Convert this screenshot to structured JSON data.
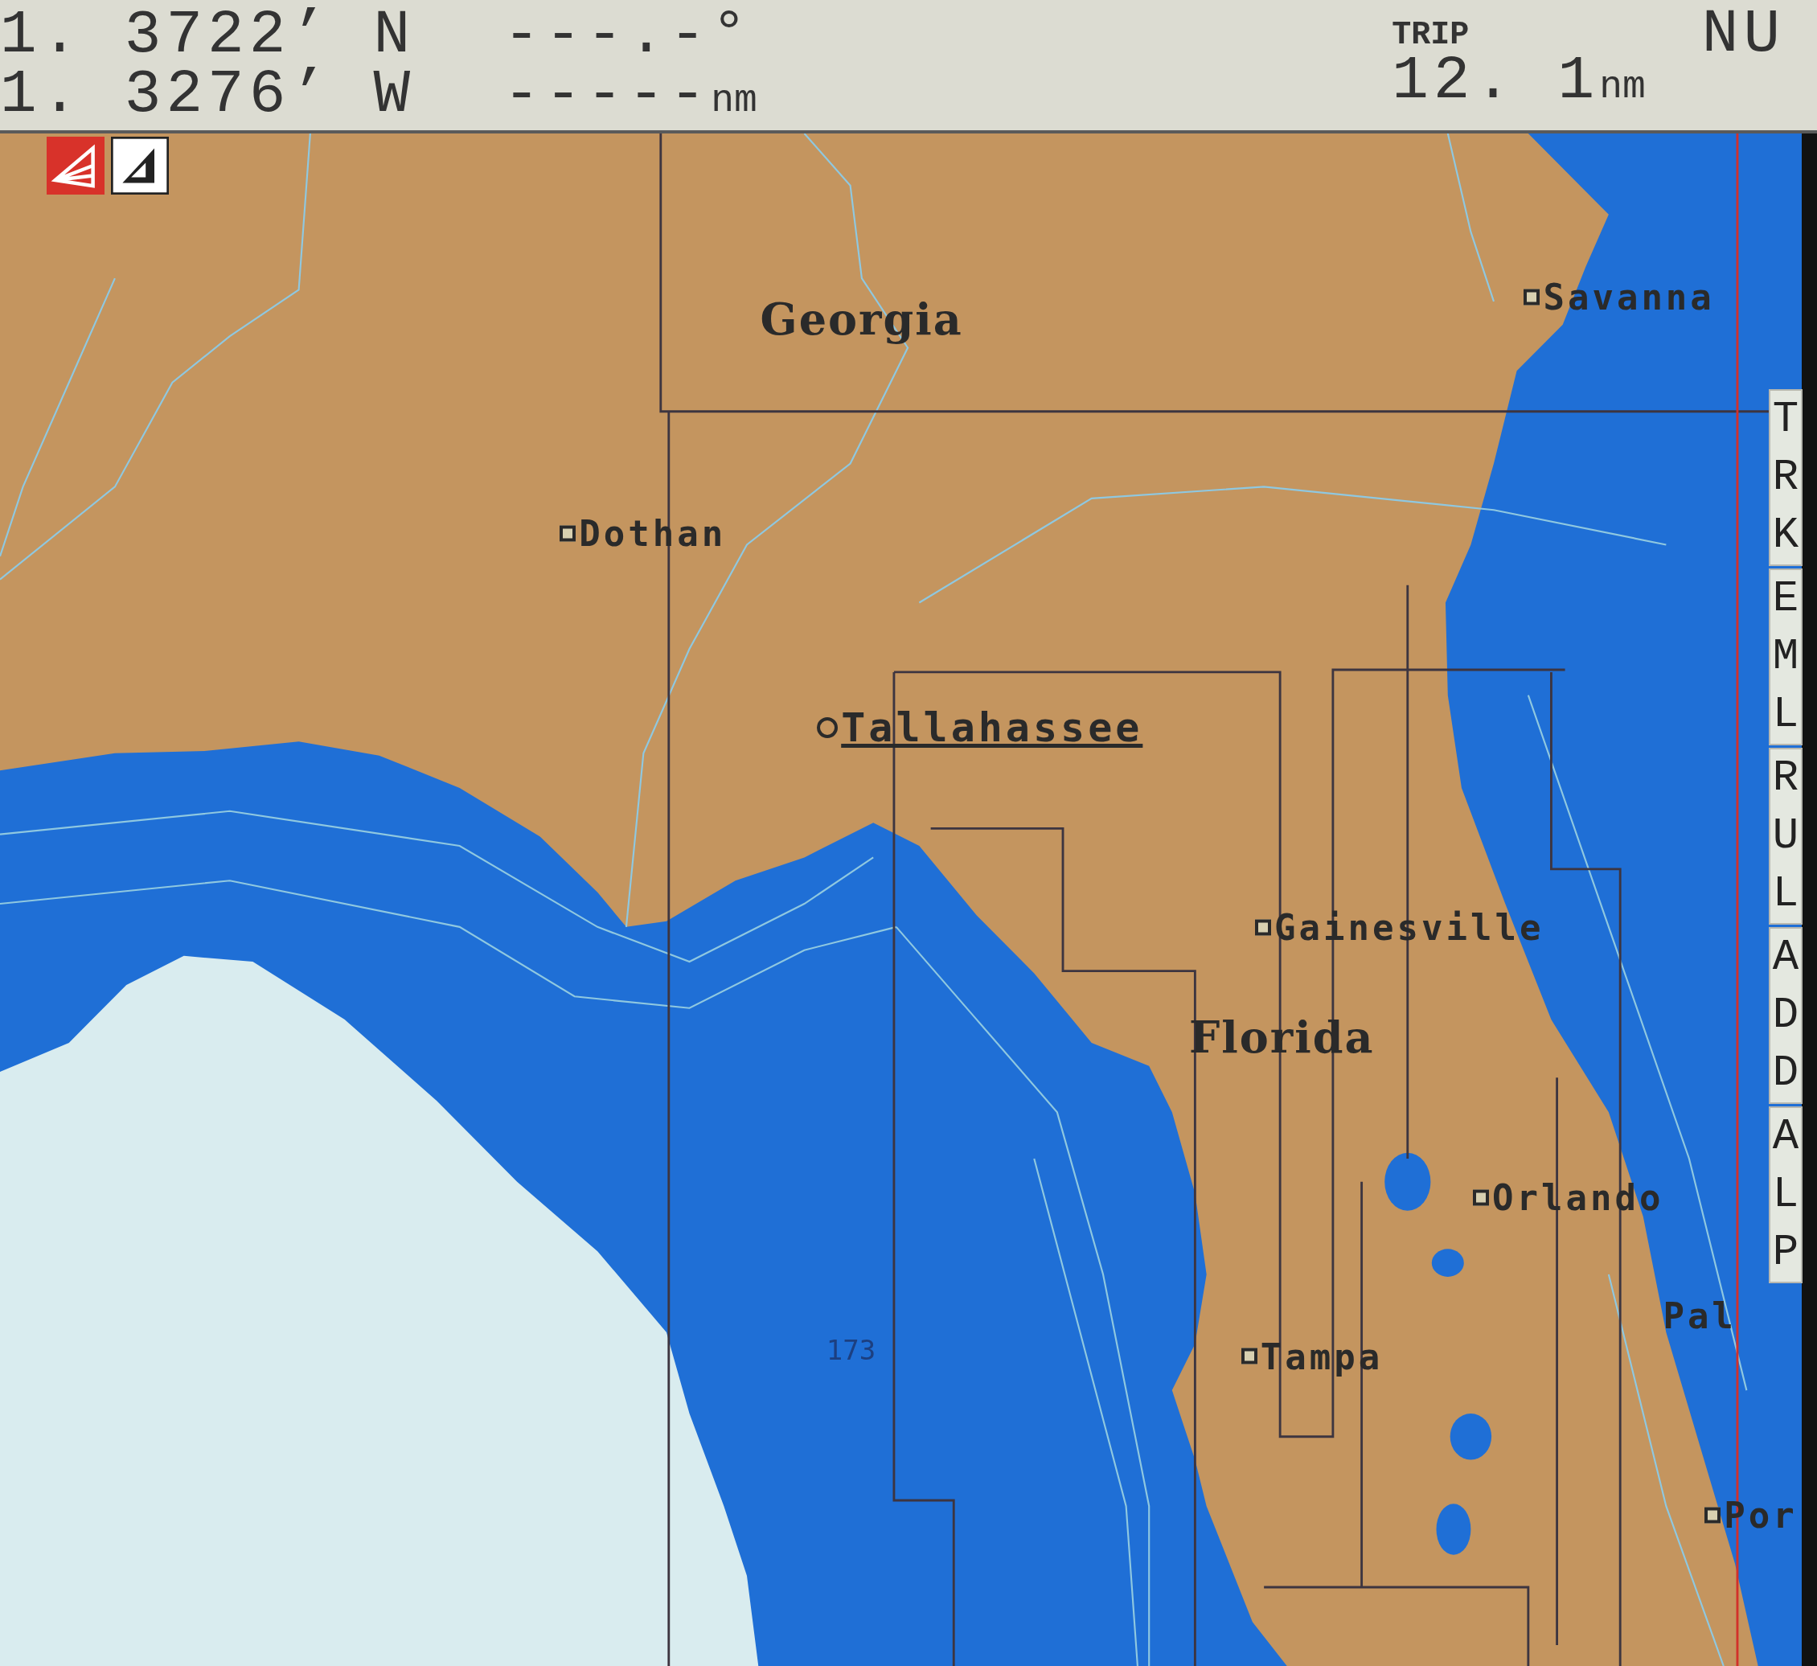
{
  "status_bar": {
    "latitude": "1. 3722’ N",
    "longitude": "1. 3276’ W",
    "heading": "---.-°",
    "distance_value": "-----",
    "distance_unit": "nm",
    "trip_label": "TRIP",
    "trip_value": "12. 1",
    "trip_unit": "nm",
    "orientation": "NU"
  },
  "map_labels": [
    {
      "text": "Georgia",
      "kind": "region"
    },
    {
      "text": "Savanna",
      "kind": "city"
    },
    {
      "text": "Dothan",
      "kind": "city"
    },
    {
      "text": "Tallahassee",
      "kind": "capital"
    },
    {
      "text": "Gainesville",
      "kind": "city"
    },
    {
      "text": "Florida",
      "kind": "region"
    },
    {
      "text": "Orlando",
      "kind": "city"
    },
    {
      "text": "Pal",
      "kind": "plain"
    },
    {
      "text": "173",
      "kind": "depth"
    },
    {
      "text": "Tampa",
      "kind": "city"
    },
    {
      "text": "Por",
      "kind": "city"
    }
  ],
  "side_menu": [
    {
      "label": "TRK"
    },
    {
      "label": "EML"
    },
    {
      "label": "RUL"
    },
    {
      "label": "ADD"
    },
    {
      "label": "ALP"
    }
  ]
}
